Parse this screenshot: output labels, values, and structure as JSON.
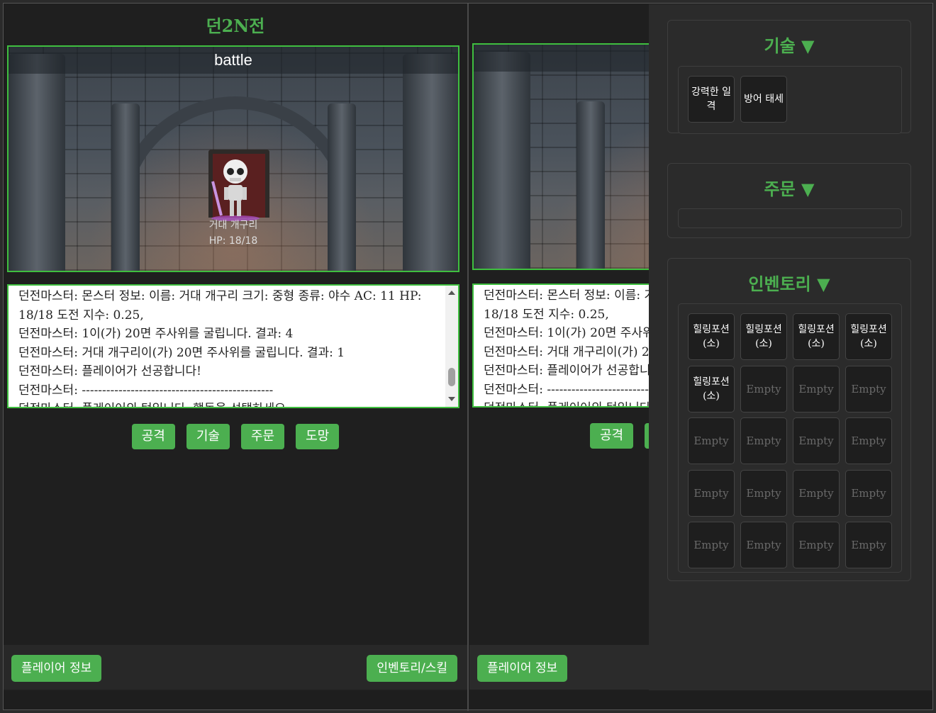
{
  "page": {
    "title": "던2N전"
  },
  "scene": {
    "title": "battle",
    "monster_name": "거대 개구리",
    "monster_hp": "HP: 18/18"
  },
  "log": {
    "lines": [
      "던전마스터: 몬스터 정보: 이름: 거대 개구리 크기: 중형 종류: 야수 AC: 11 HP: 18/18 도전 지수: 0.25,",
      "던전마스터: 1이(가) 20면 주사위를 굴립니다. 결과: 4",
      "던전마스터: 거대 개구리이(가) 20면 주사위를 굴립니다. 결과: 1",
      "던전마스터: 플레이어가 선공합니다!",
      "던전마스터: -----------------------------------------------",
      "던전마스터: 플레이어의 턴입니다. 행동을 선택하세요."
    ]
  },
  "actions": [
    "공격",
    "기술",
    "주문",
    "도망"
  ],
  "footer": {
    "player_info": "플레이어 정보",
    "inventory_skill": "인벤토리/스킬"
  },
  "side_panel": {
    "skills_title": "기술 ▼",
    "skills": [
      "강력한 일격",
      "방어 태세"
    ],
    "spells_title": "주문 ▼",
    "inventory_title": "인벤토리 ▼",
    "inventory": [
      "힐링포션 (소)",
      "힐링포션 (소)",
      "힐링포션 (소)",
      "힐링포션 (소)",
      "힐링포션 (소)",
      "Empty",
      "Empty",
      "Empty",
      "Empty",
      "Empty",
      "Empty",
      "Empty",
      "Empty",
      "Empty",
      "Empty",
      "Empty",
      "Empty",
      "Empty",
      "Empty",
      "Empty"
    ]
  },
  "colors": {
    "accent": "#4caf50",
    "background": "#1f1f1f",
    "panel": "#2b2b2b"
  }
}
